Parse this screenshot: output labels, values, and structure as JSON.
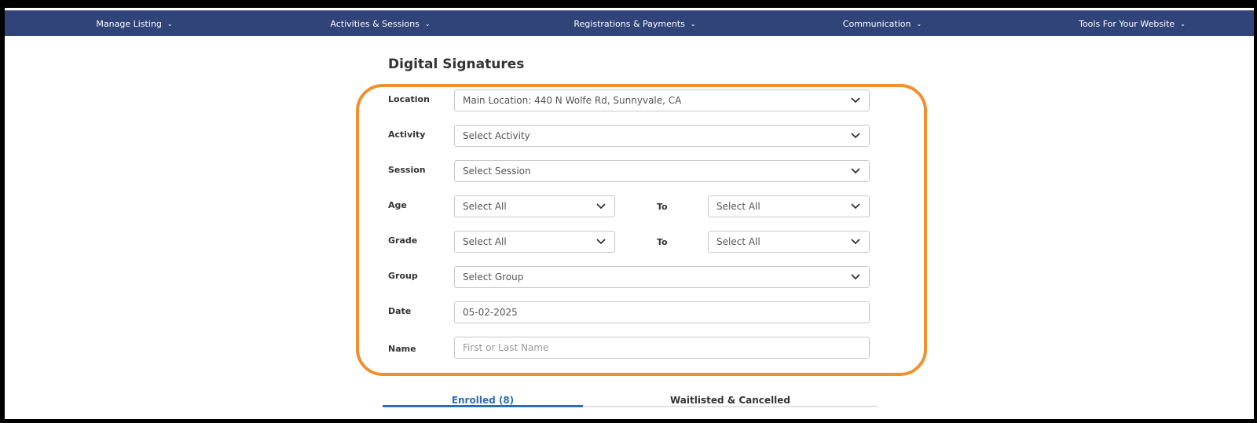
{
  "nav": {
    "items": [
      {
        "label": "Manage Listing"
      },
      {
        "label": "Activities & Sessions"
      },
      {
        "label": "Registrations & Payments"
      },
      {
        "label": "Communication"
      },
      {
        "label": "Tools For Your Website"
      }
    ]
  },
  "page": {
    "title": "Digital Signatures"
  },
  "form": {
    "location": {
      "label": "Location",
      "value": "Main Location: 440 N Wolfe Rd, Sunnyvale, CA"
    },
    "activity": {
      "label": "Activity",
      "value": "Select Activity"
    },
    "session": {
      "label": "Session",
      "value": "Select Session"
    },
    "age": {
      "label": "Age",
      "from": "Select All",
      "to_label": "To",
      "to": "Select All"
    },
    "grade": {
      "label": "Grade",
      "from": "Select All",
      "to_label": "To",
      "to": "Select All"
    },
    "group": {
      "label": "Group",
      "value": "Select Group"
    },
    "date": {
      "label": "Date",
      "value": "05-02-2025"
    },
    "name": {
      "label": "Name",
      "placeholder": "First or Last Name"
    }
  },
  "tabs": {
    "enrolled": "Enrolled (8)",
    "waitlisted": "Waitlisted & Cancelled"
  },
  "colors": {
    "nav_bg": "#304479",
    "highlight": "#f0902e",
    "active_tab": "#2e6db5"
  }
}
